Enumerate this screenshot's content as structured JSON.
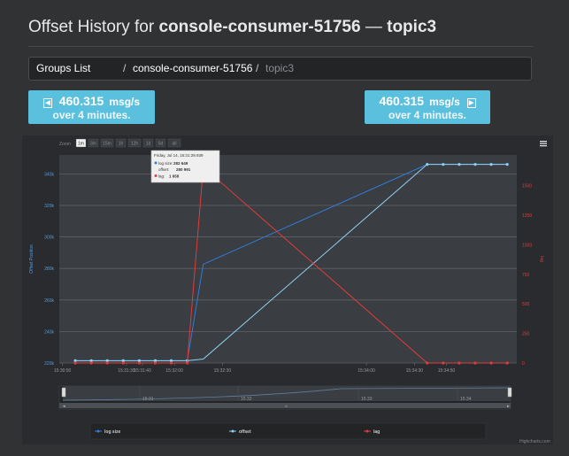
{
  "page": {
    "title_prefix": "Offset History for ",
    "group": "console-consumer-51756",
    "separator": " — ",
    "topic": "topic3"
  },
  "breadcrumb": {
    "items": [
      "Groups List",
      "console-consumer-51756",
      "topic3"
    ],
    "separator": "/"
  },
  "rates": [
    {
      "value": "460.315",
      "unit": "msg/s",
      "period": "over 4 minutes.",
      "arrow": "left-arrow-icon"
    },
    {
      "value": "460.315",
      "unit": "msg/s",
      "period": "over 4 minutes.",
      "arrow": "right-arrow-icon"
    }
  ],
  "chart_toolbar": {
    "zoom_label": "Zoom",
    "buttons": [
      "1m",
      "3m",
      "15m",
      "1h",
      "12h",
      "1d",
      "5d",
      "all"
    ],
    "selected": "1m",
    "menu_icon": "hamburger-menu-icon"
  },
  "tooltip": {
    "time": "Friday, Jul 14, 15:31:29.939",
    "lines": [
      {
        "label": "log size:",
        "value": "282 649",
        "color": "#2f7ed8"
      },
      {
        "label": "offset:",
        "value": "280 991",
        "color": "#9ad0f5"
      },
      {
        "label": "lag:",
        "value": "1 658",
        "color": "#e03c3c"
      }
    ]
  },
  "navigator": {
    "labels": [
      "15:31",
      "15:32",
      "15:33",
      "15:34"
    ],
    "center_handle": "III"
  },
  "credits": "Highcharts.com",
  "colors": {
    "log_size": "#2f7ed8",
    "offset": "#8ed2f2",
    "lag": "#e03c3c",
    "accent": "#5bc0de"
  },
  "chart_data": {
    "type": "line",
    "x": [
      "15:30:58",
      "15:31:08",
      "15:31:18",
      "15:31:28",
      "15:31:38",
      "15:31:48",
      "15:31:58",
      "15:32:08",
      "15:32:18",
      "15:34:38",
      "15:34:48",
      "15:34:58",
      "15:35:08",
      "15:35:18",
      "15:35:28"
    ],
    "x_ticks": [
      "15:30:50",
      "15:31:30",
      "15:31:40",
      "15:32:00",
      "15:32:30",
      "15:34:00",
      "15:34:30",
      "15:34:50"
    ],
    "series": [
      {
        "name": "log size",
        "axis": "left",
        "values": [
          221500,
          221500,
          221500,
          221500,
          221500,
          221500,
          221500,
          221500,
          282649,
          346000,
          346000,
          346000,
          346000,
          346000,
          346000
        ]
      },
      {
        "name": "offset",
        "axis": "left",
        "values": [
          221500,
          221500,
          221500,
          221500,
          221500,
          221500,
          221500,
          221500,
          222500,
          346000,
          346000,
          346000,
          346000,
          346000,
          346000
        ]
      },
      {
        "name": "lag",
        "axis": "right",
        "values": [
          0,
          0,
          0,
          0,
          0,
          0,
          0,
          0,
          1658,
          0,
          0,
          0,
          0,
          0,
          0
        ]
      }
    ],
    "yaxis_left": {
      "label": "Offset Position",
      "ticks": [
        "220k",
        "240k",
        "260k",
        "280k",
        "300k",
        "320k",
        "340k"
      ]
    },
    "yaxis_right": {
      "label": "lag",
      "ticks": [
        "0",
        "250",
        "500",
        "750",
        "1000",
        "1250",
        "1500"
      ]
    },
    "legend": [
      "log size",
      "offset",
      "lag"
    ],
    "legend_position": "bottom"
  }
}
